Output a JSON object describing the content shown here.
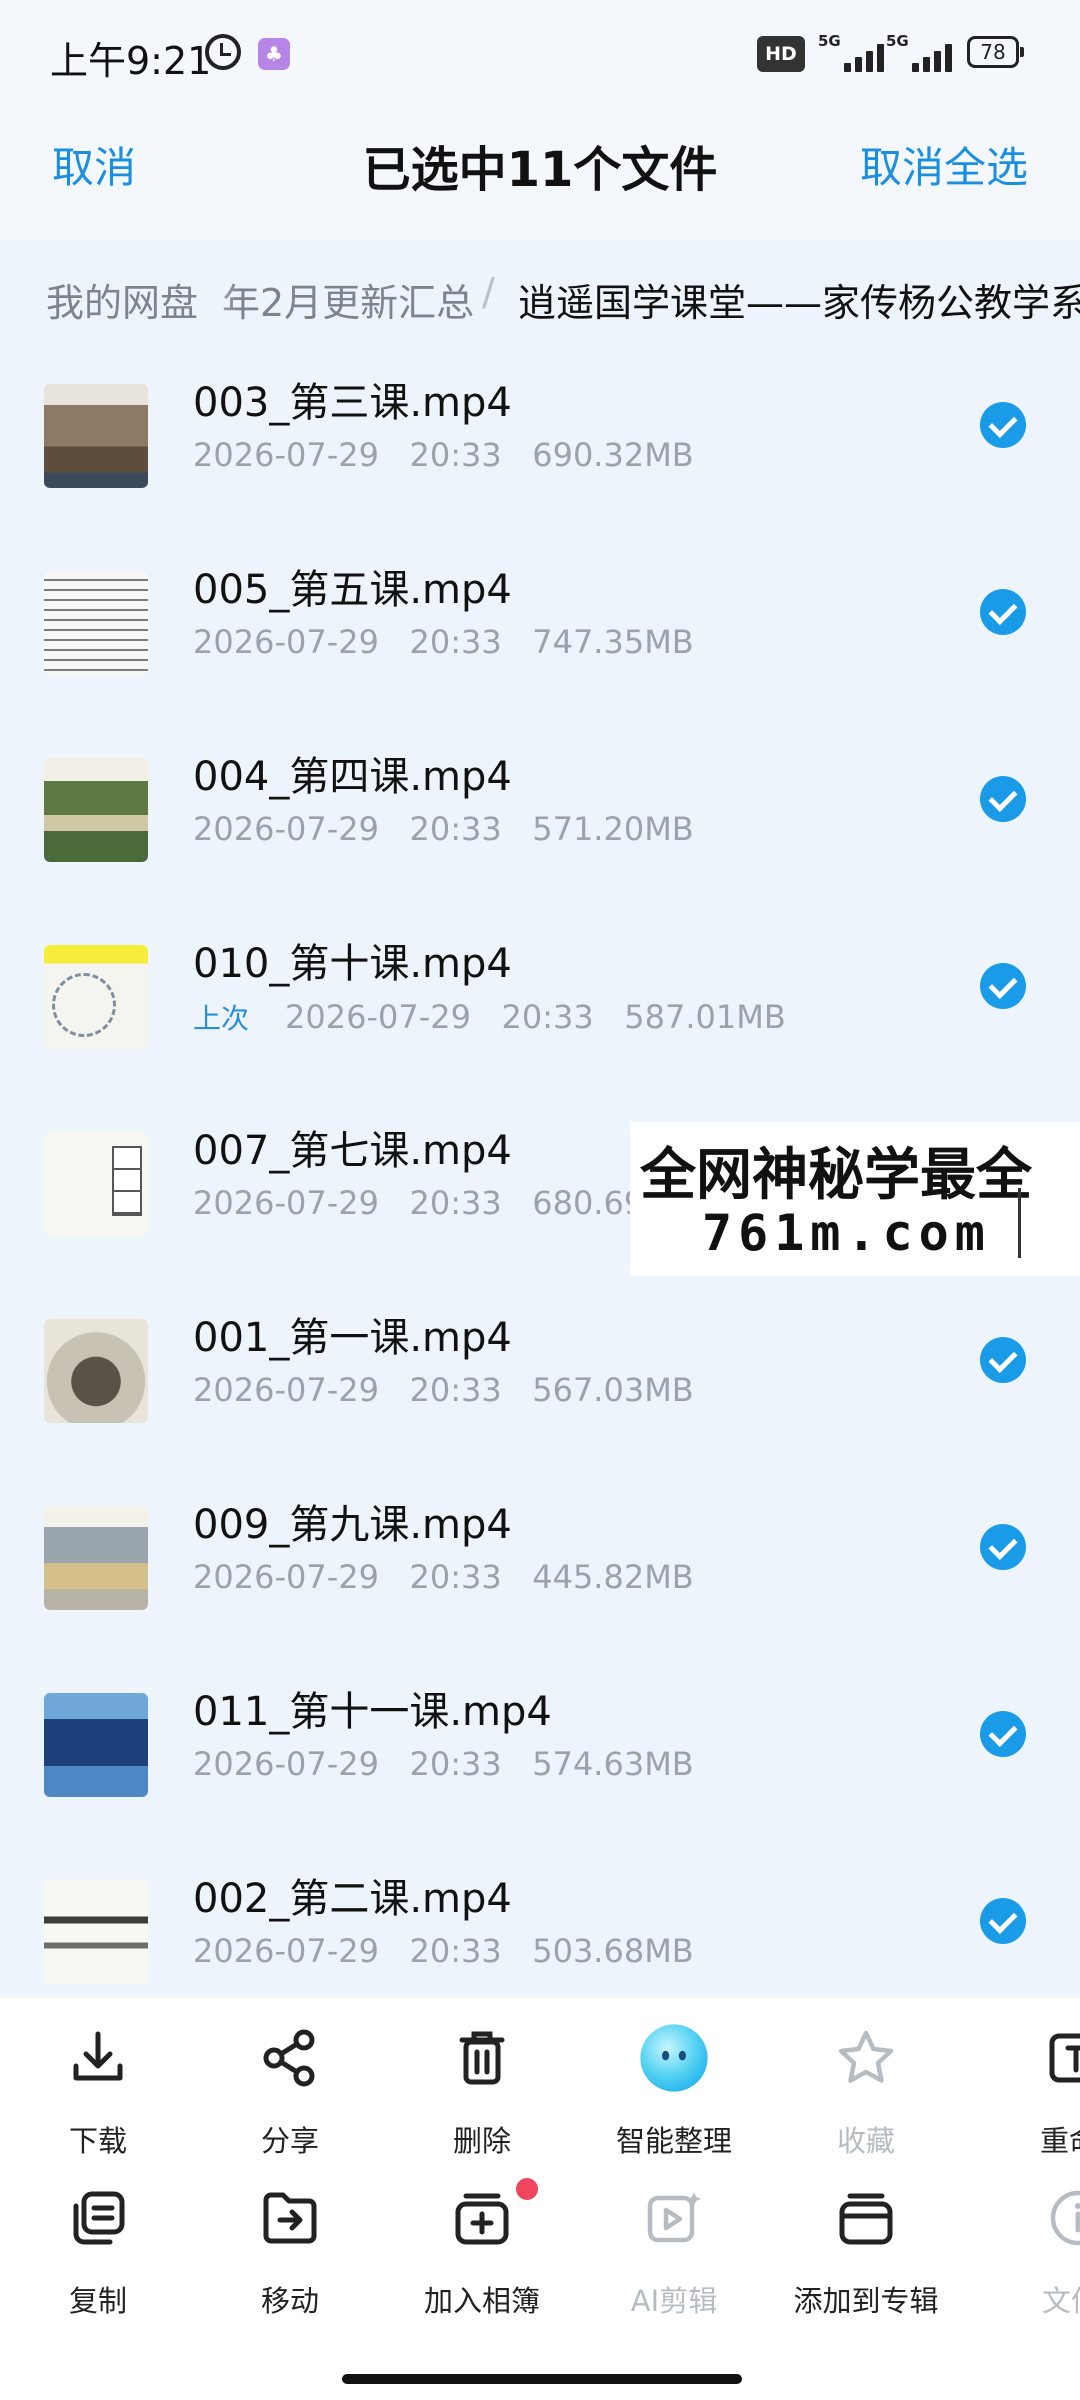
{
  "status_bar": {
    "time": "上午9:21",
    "hd_badge": "HD",
    "signal_1": "5G",
    "signal_2": "5G",
    "battery": "78"
  },
  "header": {
    "cancel_label": "取消",
    "title": "已选中11个文件",
    "deselect_all_label": "取消全选"
  },
  "breadcrumb": {
    "root": "我的网盘",
    "middle": "年2月更新汇总",
    "separator": "/",
    "current": "逍遥国学课堂——家传杨公教学系"
  },
  "files": [
    {
      "name": "003_第三课.mp4",
      "date": "2026-07-29",
      "time": "20:33",
      "size": "690.32MB",
      "tag": "",
      "selected": true
    },
    {
      "name": "005_第五课.mp4",
      "date": "2026-07-29",
      "time": "20:33",
      "size": "747.35MB",
      "tag": "",
      "selected": true
    },
    {
      "name": "004_第四课.mp4",
      "date": "2026-07-29",
      "time": "20:33",
      "size": "571.20MB",
      "tag": "",
      "selected": true
    },
    {
      "name": "010_第十课.mp4",
      "date": "2026-07-29",
      "time": "20:33",
      "size": "587.01MB",
      "tag": "上次",
      "selected": true
    },
    {
      "name": "007_第七课.mp4",
      "date": "2026-07-29",
      "time": "20:33",
      "size": "680.69MB",
      "tag": "",
      "selected": true
    },
    {
      "name": "001_第一课.mp4",
      "date": "2026-07-29",
      "time": "20:33",
      "size": "567.03MB",
      "tag": "",
      "selected": true
    },
    {
      "name": "009_第九课.mp4",
      "date": "2026-07-29",
      "time": "20:33",
      "size": "445.82MB",
      "tag": "",
      "selected": true
    },
    {
      "name": "011_第十一课.mp4",
      "date": "2026-07-29",
      "time": "20:33",
      "size": "574.63MB",
      "tag": "",
      "selected": true
    },
    {
      "name": "002_第二课.mp4",
      "date": "2026-07-29",
      "time": "20:33",
      "size": "503.68MB",
      "tag": "",
      "selected": true
    }
  ],
  "watermark": {
    "line1": "全网神秘学最全",
    "line2": "761m.com"
  },
  "actions": [
    {
      "label": "下载",
      "icon": "download-icon",
      "enabled": true
    },
    {
      "label": "分享",
      "icon": "share-icon",
      "enabled": true
    },
    {
      "label": "删除",
      "icon": "trash-icon",
      "enabled": true
    },
    {
      "label": "智能整理",
      "icon": "smart-organize-icon",
      "enabled": true
    },
    {
      "label": "收藏",
      "icon": "star-icon",
      "enabled": false
    },
    {
      "label": "重命",
      "icon": "rename-icon",
      "enabled": true
    },
    {
      "label": "复制",
      "icon": "copy-icon",
      "enabled": true
    },
    {
      "label": "移动",
      "icon": "move-icon",
      "enabled": true
    },
    {
      "label": "加入相簿",
      "icon": "add-album-icon",
      "enabled": true
    },
    {
      "label": "AI剪辑",
      "icon": "ai-edit-icon",
      "enabled": false
    },
    {
      "label": "添加到专辑",
      "icon": "add-to-album-icon",
      "enabled": true
    },
    {
      "label": "文件",
      "icon": "file-info-icon",
      "enabled": false
    }
  ],
  "colors": {
    "accent": "#1a8fe0",
    "check": "#1a9be8",
    "background": "#eef4fb",
    "notification_dot": "#f0455e"
  }
}
